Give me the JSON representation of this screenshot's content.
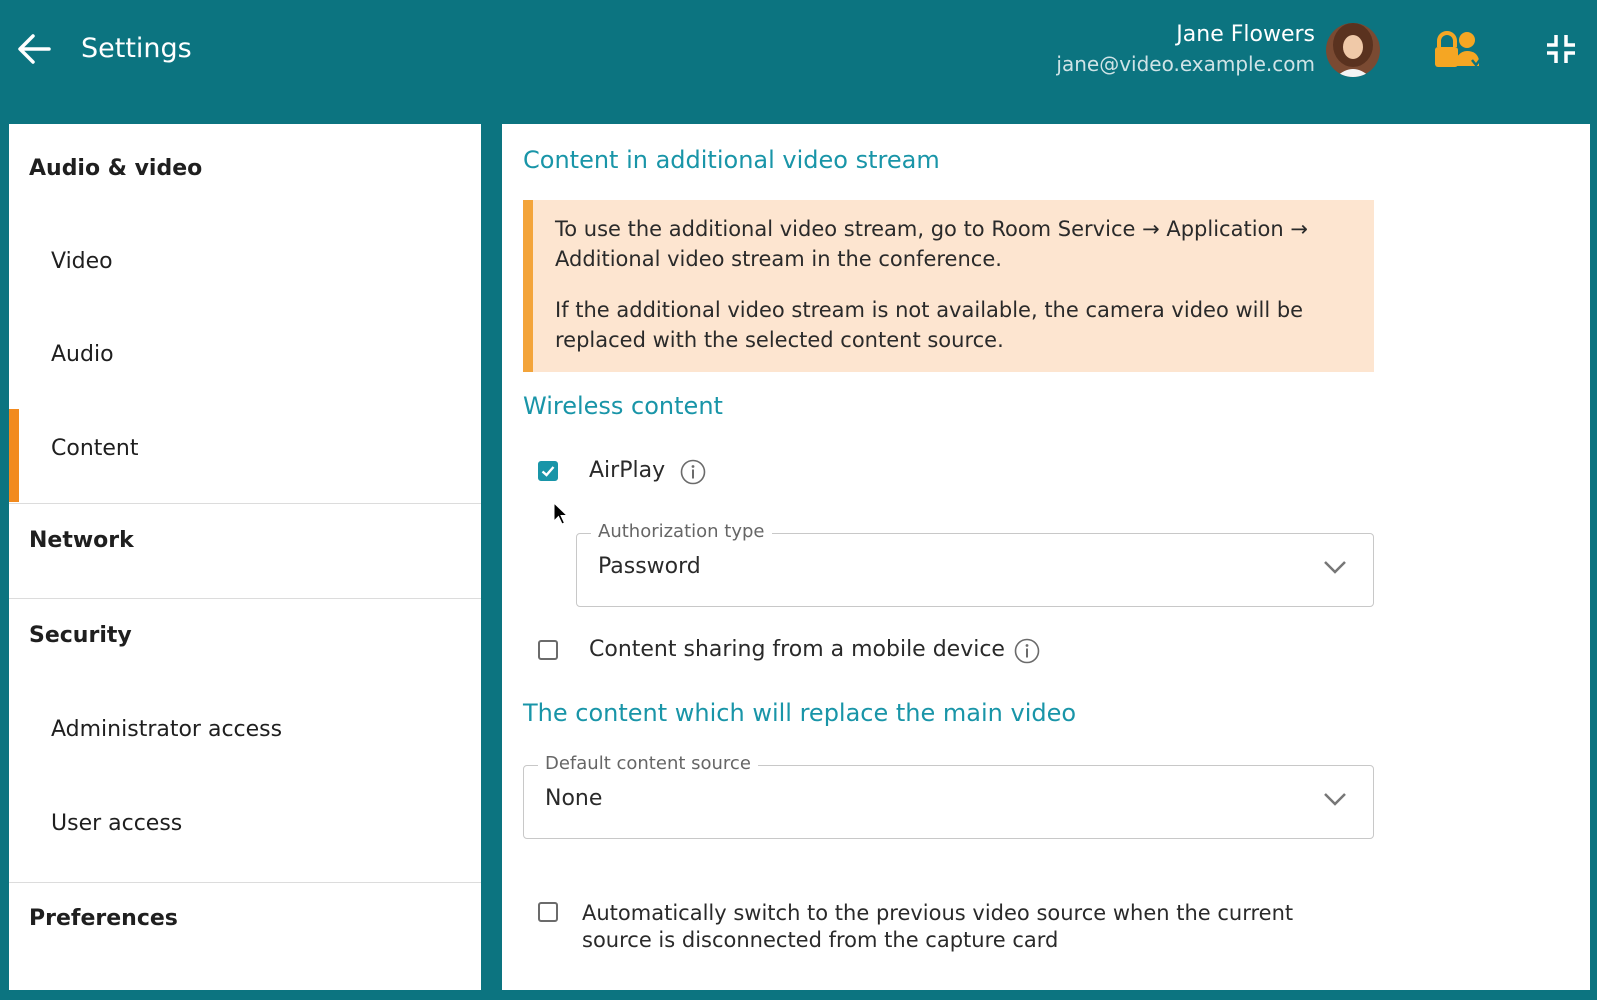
{
  "header": {
    "title": "Settings",
    "user_name": "Jane Flowers",
    "user_email": "jane@video.example.com",
    "icons": {
      "back": "arrow-left-icon",
      "lock": "lock-user-icon",
      "exit_fullscreen": "exit-fullscreen-icon"
    }
  },
  "sidebar": {
    "sections": [
      {
        "label": "Audio & video"
      },
      {
        "label": "Network"
      },
      {
        "label": "Security"
      },
      {
        "label": "Preferences"
      }
    ],
    "items": [
      {
        "label": "Video"
      },
      {
        "label": "Audio"
      },
      {
        "label": "Content",
        "active": true
      },
      {
        "label": "Administrator access"
      },
      {
        "label": "User access"
      }
    ]
  },
  "main": {
    "sections": {
      "additional_stream": "Content in additional video stream",
      "wireless": "Wireless content",
      "replace_main": "The content which will replace the main video"
    },
    "notice": {
      "line1": "To use the additional video stream, go to Room Service → Application → Additional video stream in the conference.",
      "line2": "If the additional video stream is not available, the camera video will be replaced with the selected content source."
    },
    "airplay": {
      "label": "AirPlay",
      "checked": true
    },
    "auth_type": {
      "legend": "Authorization type",
      "value": "Password"
    },
    "mobile_sharing": {
      "label": "Content sharing from a mobile device",
      "checked": false
    },
    "default_source": {
      "legend": "Default content source",
      "value": "None"
    },
    "auto_switch": {
      "label": "Automatically switch to the previous video source when the current source is disconnected from the capture card",
      "checked": false
    }
  },
  "colors": {
    "header_bg": "#0c7480",
    "accent": "#1995a8",
    "active_marker": "#f28a1e",
    "notice_bg": "#fde5d0",
    "notice_bar": "#f3a43a",
    "lock_icon": "#f5a623"
  }
}
